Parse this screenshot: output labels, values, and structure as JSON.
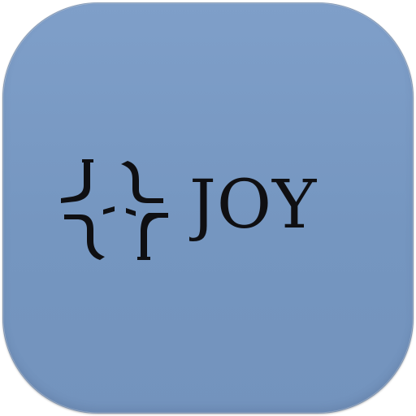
{
  "app_icon": {
    "name": "JOY",
    "wordmark": "JOY",
    "mark_icon": "joy-four-hooks-mark-icon",
    "background_color": "#7596c0",
    "ink_color": "#0f0f12"
  }
}
